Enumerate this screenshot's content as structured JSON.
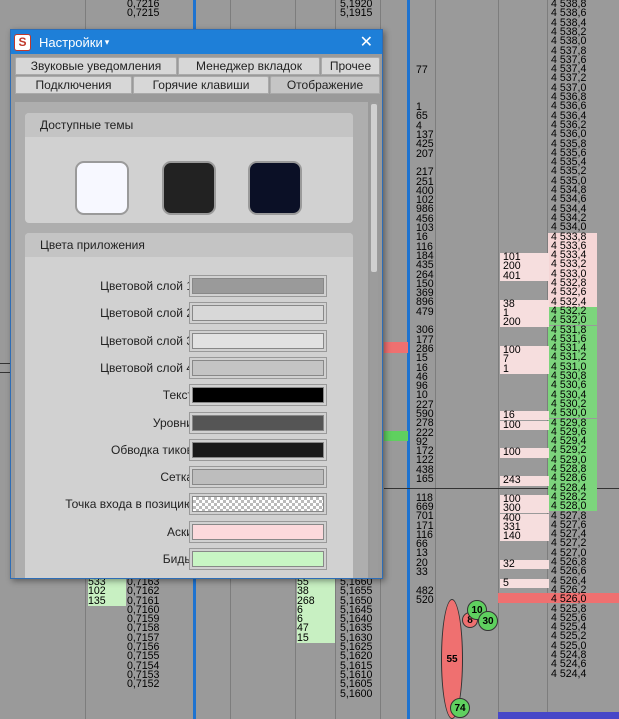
{
  "dialog": {
    "title": "Настройки",
    "caret": "▾",
    "close": "✕",
    "tabs_row1": [
      "Звуковые уведомления",
      "Менеджер вкладок",
      "Прочее"
    ],
    "tabs_row2": [
      "Подключения",
      "Горячие клавиши",
      "Отображение"
    ],
    "active_tab": "Отображение",
    "themes_header": "Доступные темы",
    "themes": [
      {
        "color": "#f7f8ff",
        "border": "#9a9a9a"
      },
      {
        "color": "#222222",
        "border": "#9a9a9a"
      },
      {
        "color": "#0b1026",
        "border": "#9a9a9a"
      }
    ],
    "colors_header": "Цвета приложения",
    "colors": [
      {
        "label": "Цветовой слой 1",
        "color": "#9a9a9a"
      },
      {
        "label": "Цветовой слой 2",
        "color": "#d8d8d8"
      },
      {
        "label": "Цветовой слой 3",
        "color": "#e2e2e2"
      },
      {
        "label": "Цветовой слой 4",
        "color": "#c4c4c4"
      },
      {
        "label": "Текст",
        "color": "#000000"
      },
      {
        "label": "Уровни",
        "color": "#555555"
      },
      {
        "label": "Обводка тиков",
        "color": "#1a1a1a"
      },
      {
        "label": "Сетка",
        "color": "#bdbdbd"
      },
      {
        "label": "Точка входа в позицию",
        "color": "checker"
      },
      {
        "label": "Аски",
        "color": "#fcd9dc"
      },
      {
        "label": "Биды",
        "color": "#c8f5c4"
      }
    ]
  },
  "background": {
    "col_a_top": [
      "0,7216",
      "0,7215"
    ],
    "col_a_bottom": [
      "0,7163",
      "0,7162",
      "0,7161",
      "0,7160",
      "0,7159",
      "0,7158",
      "0,7157",
      "0,7156",
      "0,7155",
      "0,7154",
      "0,7153",
      "0,7152"
    ],
    "col_a_vol": [
      "533",
      "102",
      "135"
    ],
    "col_b_top": [
      "5,1920",
      "5,1915"
    ],
    "col_b_vol": [
      "55",
      "38",
      "268",
      "6",
      "6",
      "47",
      "15"
    ],
    "col_b_bottom": [
      "5,1660",
      "5,1655",
      "5,1650",
      "5,1645",
      "5,1640",
      "5,1635",
      "5,1630",
      "5,1625",
      "5,1620",
      "5,1615",
      "5,1610",
      "5,1605",
      "5,1600"
    ],
    "col_c": [
      "77",
      "",
      "",
      "",
      "1",
      "65",
      "4",
      "137",
      "425",
      "207",
      "",
      "217",
      "251",
      "400",
      "102",
      "986",
      "456",
      "103",
      "16",
      "116",
      "184",
      "435",
      "264",
      "150",
      "369",
      "896",
      "479",
      "",
      "306",
      "177",
      "286",
      "15",
      "16",
      "46",
      "96",
      "10",
      "227",
      "590",
      "278",
      "222",
      "92",
      "172",
      "122",
      "438",
      "165",
      "",
      "118",
      "669",
      "701",
      "171",
      "116",
      "66",
      "13",
      "20",
      "33",
      "",
      "482",
      "520"
    ],
    "ladder": [
      "4 538,8",
      "4 538,6",
      "4 538,4",
      "4 538,2",
      "4 538,0",
      "4 537,8",
      "4 537,6",
      "4 537,4",
      "4 537,2",
      "4 537,0",
      "4 536,8",
      "4 536,6",
      "4 536,4",
      "4 536,2",
      "4 536,0",
      "4 535,8",
      "4 535,6",
      "4 535,4",
      "4 535,2",
      "4 535,0",
      "4 534,8",
      "4 534,6",
      "4 534,4",
      "4 534,2",
      "4 534,0",
      "4 533,8",
      "4 533,6",
      "4 533,4",
      "4 533,2",
      "4 533,0",
      "4 532,8",
      "4 532,6",
      "4 532,4",
      "4 532,2",
      "4 532,0",
      "4 531,8",
      "4 531,6",
      "4 531,4",
      "4 531,2",
      "4 531,0",
      "4 530,8",
      "4 530,6",
      "4 530,4",
      "4 530,2",
      "4 530,0",
      "4 529,8",
      "4 529,6",
      "4 529,4",
      "4 529,2",
      "4 529,0",
      "4 528,8",
      "4 528,6",
      "4 528,4",
      "4 528,2",
      "4 528,0",
      "4 527,8",
      "4 527,6",
      "4 527,4",
      "4 527,2",
      "4 527,0",
      "4 526,8",
      "4 526,6",
      "4 526,4",
      "4 526,2",
      "4 526,0",
      "4 525,8",
      "4 525,6",
      "4 525,4",
      "4 525,2",
      "4 525,0",
      "4 524,8",
      "4 524,6",
      "4 524,4"
    ],
    "asks": [
      [
        "101",
        27
      ],
      [
        "200",
        28
      ],
      [
        "401",
        29
      ],
      [
        "38",
        32
      ],
      [
        "1",
        33
      ],
      [
        "200",
        34
      ],
      [
        "100",
        37
      ],
      [
        "7",
        38
      ],
      [
        "1",
        39
      ],
      [
        "16",
        44
      ],
      [
        "100",
        45
      ],
      [
        "100",
        48
      ],
      [
        "243",
        51
      ],
      [
        "100",
        53
      ],
      [
        "300",
        54
      ],
      [
        "400",
        55
      ],
      [
        "331",
        56
      ],
      [
        "140",
        57
      ],
      [
        "32",
        60
      ],
      [
        "5",
        62
      ]
    ],
    "bubbles": [
      {
        "label": "8",
        "bg": "#ef7070"
      },
      {
        "label": "10",
        "bg": "#5fd05f"
      },
      {
        "label": "30",
        "bg": "#5fd05f"
      },
      {
        "label": "55",
        "bg": "#ef7070"
      },
      {
        "label": "74",
        "bg": "#5fd05f"
      }
    ]
  }
}
